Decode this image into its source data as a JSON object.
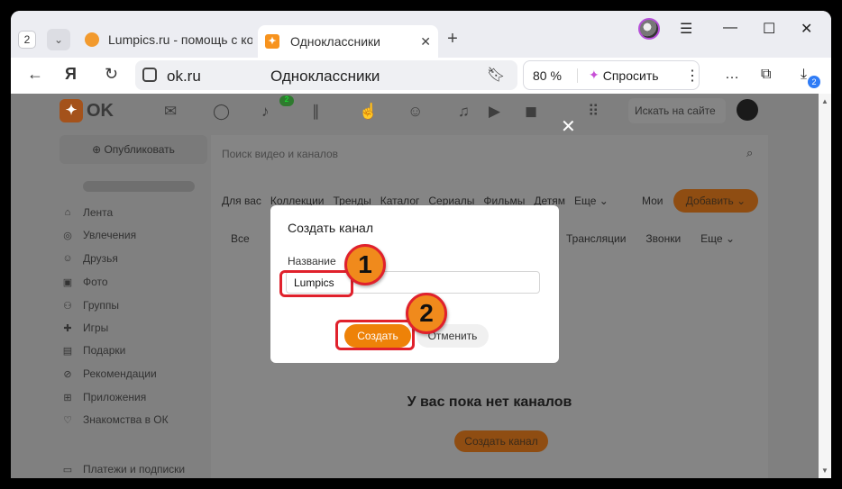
{
  "browser": {
    "tab_count": "2",
    "tabs": [
      {
        "title": "Lumpics.ru - помощь с ком",
        "close": ""
      },
      {
        "title": "Одноклассники",
        "close": "✕"
      }
    ],
    "url": "ok.ru",
    "page_title": "Одноклассники",
    "zoom": "80 %",
    "ask_label": "Спросить",
    "downloads_badge": "2"
  },
  "ok": {
    "logo_text": "OK",
    "notif_badge": "2",
    "search_placeholder": "Искать на сайте",
    "publish_label": "Опубликовать",
    "sidebar": [
      {
        "label": "Лента",
        "icon": "home-icon"
      },
      {
        "label": "Увлечения",
        "icon": "hobby-icon"
      },
      {
        "label": "Друзья",
        "icon": "friends-icon"
      },
      {
        "label": "Фото",
        "icon": "photo-icon"
      },
      {
        "label": "Группы",
        "icon": "groups-icon"
      },
      {
        "label": "Игры",
        "icon": "games-icon"
      },
      {
        "label": "Подарки",
        "icon": "gifts-icon"
      },
      {
        "label": "Рекомендации",
        "icon": "recommendations-icon"
      },
      {
        "label": "Приложения",
        "icon": "apps-icon"
      },
      {
        "label": "Знакомства в ОК",
        "icon": "dating-icon"
      },
      {
        "label": "Платежи и подписки",
        "icon": "payments-icon"
      }
    ],
    "video_search_placeholder": "Поиск видео и каналов",
    "video_tabs": [
      "Для вас",
      "Коллекции",
      "Тренды",
      "Каталог",
      "Сериалы",
      "Фильмы",
      "Детям",
      "Еще"
    ],
    "mine_label": "Мои",
    "add_label": "Добавить",
    "sub_all": "Все",
    "sub_tabs_right": [
      "Трансляции",
      "Звонки",
      "Еще"
    ],
    "empty_title": "У вас пока нет каналов",
    "create_channel_label": "Создать канал"
  },
  "modal": {
    "title": "Создать канал",
    "name_label": "Название",
    "name_value": "Lumpics",
    "create_label": "Создать",
    "cancel_label": "Отменить"
  },
  "annotations": {
    "step1": "1",
    "step2": "2",
    "highlight_color": "#e0212c",
    "marker_color": "#f08a1c"
  }
}
